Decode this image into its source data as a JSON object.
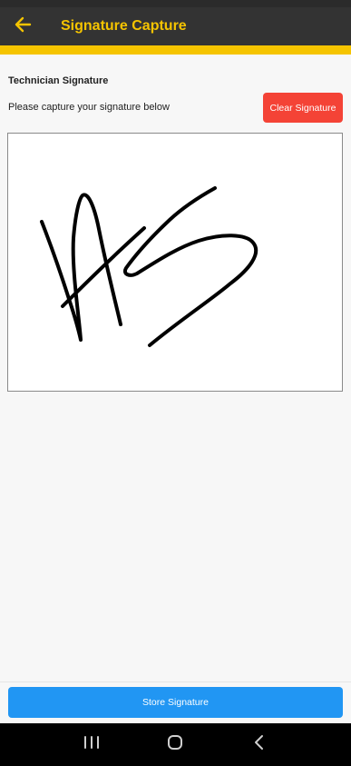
{
  "appbar": {
    "title": "Signature Capture",
    "back_icon": "arrow-left-icon",
    "accent_color": "#f5c400"
  },
  "signature": {
    "section_label": "Technician Signature",
    "instructions": "Please capture your signature below",
    "clear_label": "Clear Signature",
    "clear_color": "#f44336"
  },
  "footer": {
    "store_label": "Store Signature",
    "store_color": "#2196f3"
  },
  "system_nav": {
    "recents_icon": "recents-icon",
    "home_icon": "home-icon",
    "back_icon": "back-chevron-icon"
  }
}
